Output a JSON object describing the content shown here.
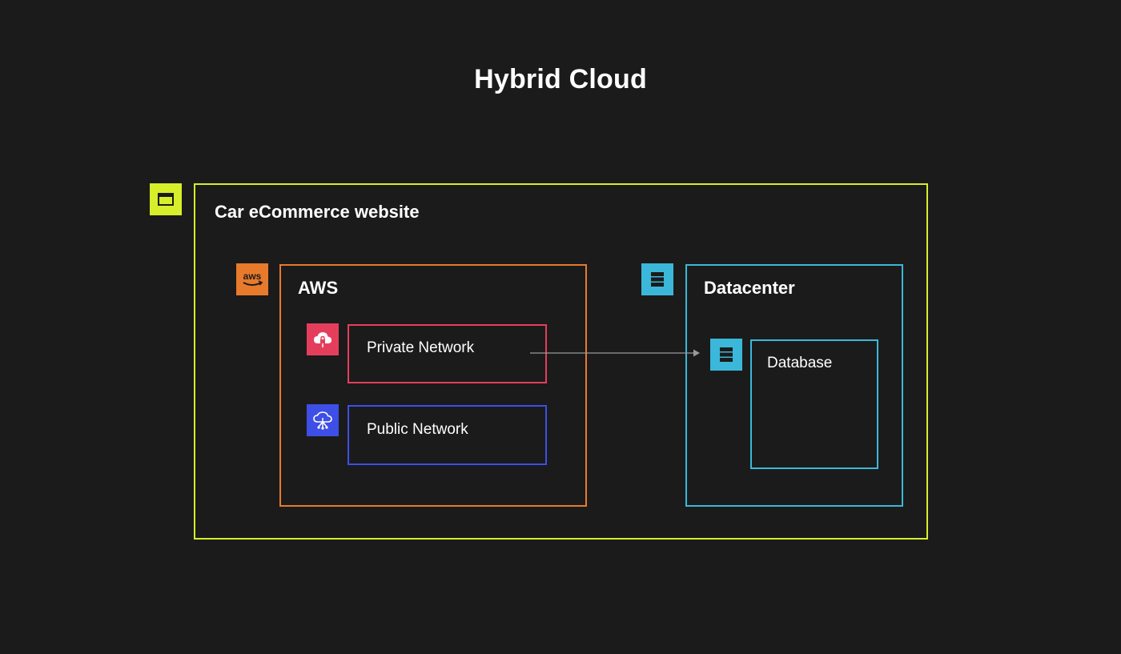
{
  "diagram": {
    "title": "Hybrid Cloud",
    "colors": {
      "background": "#1b1b1b",
      "website": "#d7ee2a",
      "aws": "#e87a2c",
      "private_network": "#e53e5c",
      "public_network": "#3d4fe6",
      "datacenter": "#3bb8d9"
    },
    "groups": {
      "website": {
        "label": "Car eCommerce website",
        "icon": "browser-window-icon"
      },
      "aws": {
        "label": "AWS",
        "icon": "aws-logo-icon"
      },
      "private_network": {
        "label": "Private Network",
        "icon": "cloud-lock-icon"
      },
      "public_network": {
        "label": "Public Network",
        "icon": "cloud-network-icon"
      },
      "datacenter": {
        "label": "Datacenter",
        "icon": "server-rack-icon"
      },
      "database": {
        "label": "Database",
        "icon": "server-rack-icon"
      }
    },
    "edges": [
      {
        "from": "private_network",
        "to": "database",
        "label": ""
      }
    ]
  }
}
